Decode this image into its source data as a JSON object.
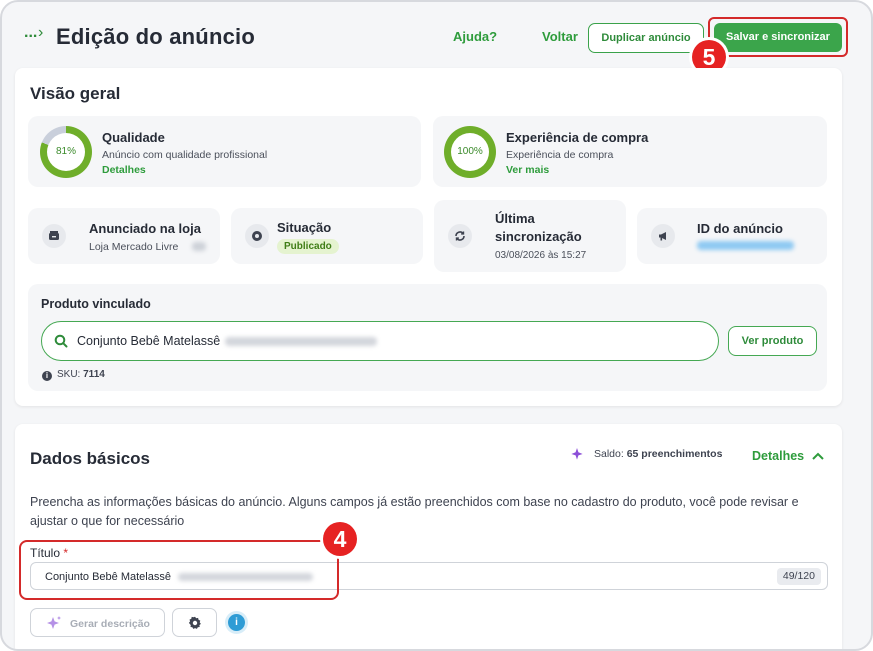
{
  "header": {
    "breadcrumb_ellipsis": "...",
    "breadcrumb_separator": "›",
    "title": "Edição do anúncio",
    "help_label": "Ajuda?",
    "back_label": "Voltar",
    "duplicate_label": "Duplicar anúncio",
    "save_label": "Salvar e sincronizar",
    "save_step": "5"
  },
  "overview": {
    "title": "Visão geral",
    "quality": {
      "title": "Qualidade",
      "percent_label": "81%",
      "percent_value": 81,
      "subtitle": "Anúncio com qualidade profissional",
      "link": "Detalhes"
    },
    "experience": {
      "title": "Experiência de compra",
      "percent_label": "100%",
      "percent_value": 100,
      "subtitle": "Experiência de compra",
      "link": "Ver mais"
    },
    "store": {
      "title": "Anunciado na loja",
      "subtitle": "Loja Mercado Livre"
    },
    "status": {
      "title": "Situação",
      "badge": "Publicado"
    },
    "sync": {
      "title_line1": "Última",
      "title_line2": "sincronização",
      "date": "03/08/2026 às 15:27"
    },
    "ad_id": {
      "title": "ID do anúncio"
    },
    "linked_product": {
      "title": "Produto vinculado",
      "search_value": "Conjunto Bebê Matelassê",
      "view_button": "Ver produto",
      "sku_prefix": "SKU: ",
      "sku_value": "7114"
    }
  },
  "basics": {
    "title": "Dados básicos",
    "balance_prefix": "Saldo: ",
    "balance_value": "65 preenchimentos",
    "details_label": "Detalhes",
    "description": "Preencha as informações básicas do anúncio. Alguns campos já estão preenchidos com base no cadastro do produto, você pode revisar e ajustar o que for necessário",
    "title_field_label": "Título",
    "title_field_required": "*",
    "title_value": "Conjunto Bebê Matelassê",
    "title_counter": "49/120",
    "title_step": "4",
    "generate_label": "Gerar descrição"
  },
  "colors": {
    "accent_green": "#3ba54b",
    "annotation_red": "#d42a2a",
    "info_blue": "#2f9cd5"
  },
  "icons": [
    "search-icon",
    "store-icon",
    "status-icon",
    "sync-icon",
    "megaphone-icon",
    "info-icon",
    "sparkle-icon",
    "gear-icon",
    "chevron-up-icon"
  ]
}
